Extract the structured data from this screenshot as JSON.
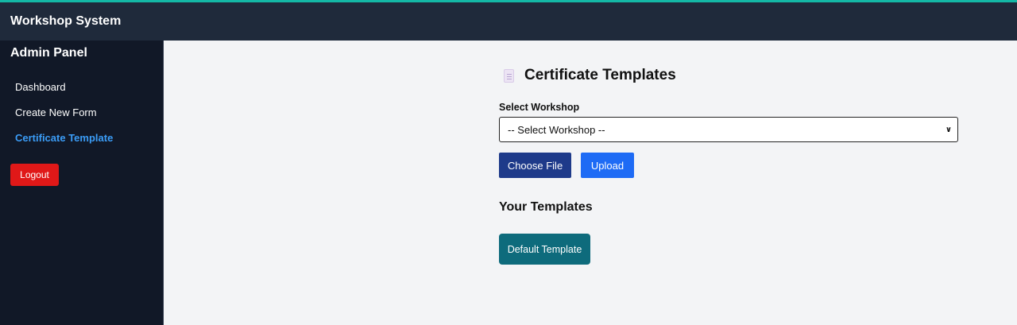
{
  "header": {
    "title": "Workshop System"
  },
  "sidebar": {
    "title": "Admin Panel",
    "items": [
      {
        "label": "Dashboard",
        "active": false
      },
      {
        "label": "Create New Form",
        "active": false
      },
      {
        "label": "Certificate Template",
        "active": true
      }
    ],
    "logout_label": "Logout"
  },
  "main": {
    "title": "Certificate Templates",
    "title_icon": "document-icon",
    "select_label": "Select Workshop",
    "select_value": "-- Select Workshop --",
    "choose_file_label": "Choose File",
    "upload_label": "Upload",
    "templates_heading": "Your Templates",
    "templates": [
      {
        "label": "Default Template"
      }
    ]
  },
  "colors": {
    "header_bg": "#1f2a3b",
    "sidebar_bg": "#111827",
    "active_link": "#3b9cf6",
    "logout": "#e01818",
    "choose_file": "#1e3a8a",
    "upload": "#1e6bf5",
    "template_button": "#0e6b7c",
    "accent_line": "#14b8a6"
  }
}
